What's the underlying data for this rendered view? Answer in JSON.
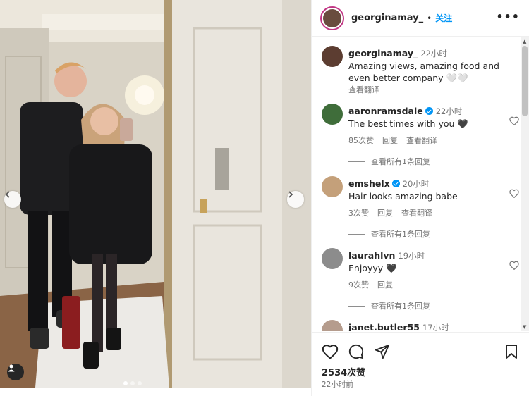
{
  "header": {
    "username": "georginamay_",
    "separator": "•",
    "follow_label": "关注",
    "more_icon": "more-icon",
    "more_label": "•••"
  },
  "caption": {
    "username": "georginamay_",
    "time": "22小时",
    "text": "Amazing views, amazing food and even better company 🤍🤍",
    "translate": "查看翻译"
  },
  "comments": [
    {
      "username": "aaronramsdale",
      "verified": true,
      "time": "22小时",
      "text": "The best times with you 🖤",
      "likes": "85次赞",
      "reply": "回复",
      "translate": "查看翻译",
      "view_replies": "查看所有1条回复"
    },
    {
      "username": "emshelx",
      "verified": true,
      "time": "20小时",
      "text": "Hair looks amazing babe",
      "likes": "3次赞",
      "reply": "回复",
      "translate": "查看翻译",
      "view_replies": "查看所有1条回复"
    },
    {
      "username": "laurahlvn",
      "verified": false,
      "time": "19小时",
      "text": "Enjoyyy 🖤",
      "likes": "9次赞",
      "reply": "回复",
      "view_replies": "查看所有1条回复"
    },
    {
      "username": "janet.butler55",
      "verified": false,
      "time": "17小时"
    }
  ],
  "footer": {
    "likes": "2534次赞",
    "posted": "22小时前"
  },
  "colors": {
    "accent": "#0095f6",
    "text": "#262626",
    "muted": "#737373"
  }
}
